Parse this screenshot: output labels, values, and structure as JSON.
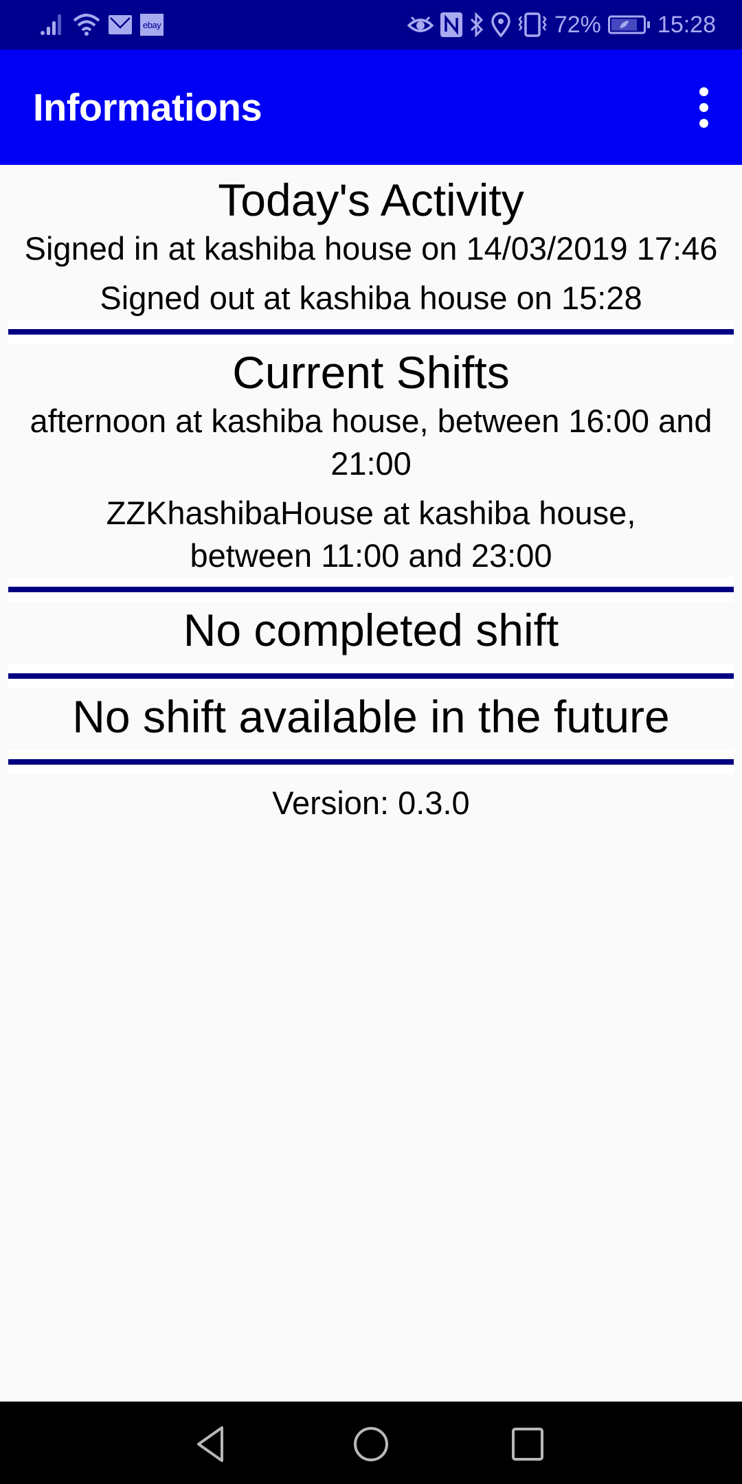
{
  "status_bar": {
    "left_icons": [
      "signal-icon",
      "wifi-icon",
      "mail-icon",
      "ebay-icon"
    ],
    "ebay_label": "ebay",
    "right_icons": [
      "eye-icon",
      "nfc-icon",
      "bluetooth-icon",
      "location-icon",
      "vibrate-icon"
    ],
    "battery_percent": "72%",
    "time": "15:28"
  },
  "app_bar": {
    "title": "Informations",
    "menu_icon": "more-vert-icon"
  },
  "sections": {
    "today": {
      "title": "Today's Activity",
      "lines": [
        "Signed in at kashiba house on 14/03/2019 17:46",
        "Signed out at kashiba house on 15:28"
      ]
    },
    "current_shifts": {
      "title": "Current Shifts",
      "lines": [
        "afternoon at kashiba house, between 16:00 and 21:00",
        "ZZKhashibaHouse at kashiba house, between 11:00 and 23:00"
      ]
    },
    "completed": {
      "title": "No completed shift"
    },
    "future": {
      "title": "No shift available in the future"
    }
  },
  "version": "Version: 0.3.0",
  "colors": {
    "status_bar": "#00008f",
    "app_bar": "#0000f5",
    "divider": "#000080",
    "background": "#fafafa"
  },
  "nav_bar": {
    "buttons": [
      "back-icon",
      "home-icon",
      "recents-icon"
    ]
  }
}
